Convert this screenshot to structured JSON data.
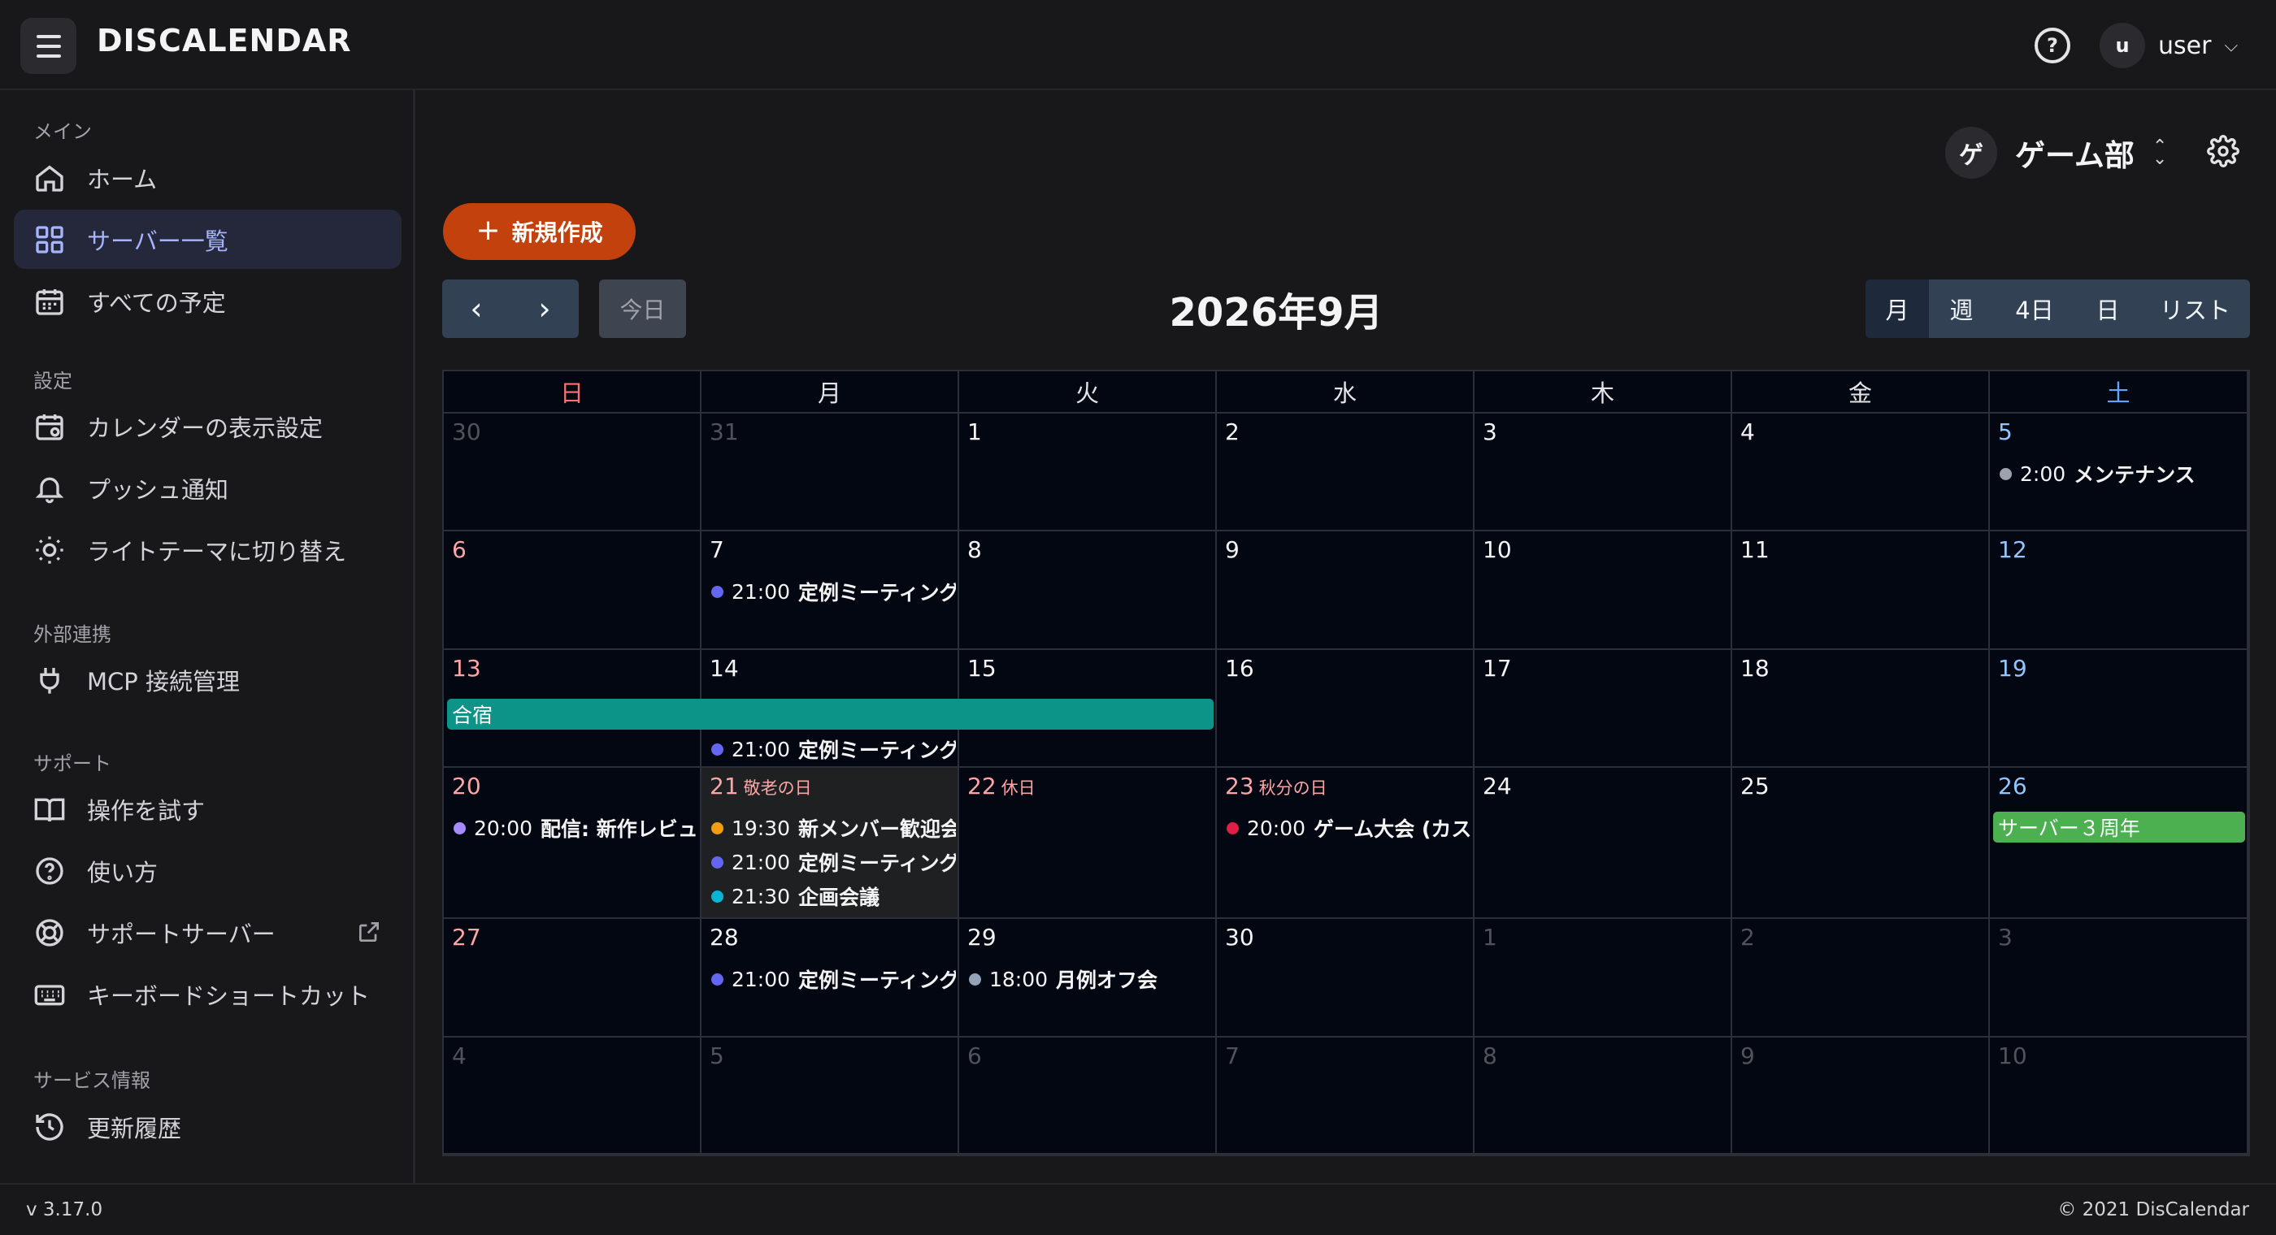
{
  "app": {
    "brand": "DISCALENDAR"
  },
  "header": {
    "help_icon": "help-circle-icon",
    "user": {
      "initial": "u",
      "name": "user"
    }
  },
  "sidebar": {
    "sections": [
      {
        "title": "メイン",
        "items": [
          {
            "label": "ホーム",
            "icon": "home-icon"
          },
          {
            "label": "サーバー一覧",
            "icon": "grid-icon",
            "active": true
          },
          {
            "label": "すべての予定",
            "icon": "calendar-icon"
          }
        ]
      },
      {
        "title": "設定",
        "items": [
          {
            "label": "カレンダーの表示設定",
            "icon": "calendar-settings-icon"
          },
          {
            "label": "プッシュ通知",
            "icon": "bell-icon"
          },
          {
            "label": "ライトテーマに切り替え",
            "icon": "sun-icon"
          }
        ]
      },
      {
        "title": "外部連携",
        "items": [
          {
            "label": "MCP 接続管理",
            "icon": "plug-icon"
          }
        ]
      },
      {
        "title": "サポート",
        "items": [
          {
            "label": "操作を試す",
            "icon": "book-icon"
          },
          {
            "label": "使い方",
            "icon": "help-circle-icon"
          },
          {
            "label": "サポートサーバー",
            "icon": "lifebuoy-icon",
            "external": true
          },
          {
            "label": "キーボードショートカット",
            "icon": "keyboard-icon"
          }
        ]
      },
      {
        "title": "サービス情報",
        "items": [
          {
            "label": "更新履歴",
            "icon": "history-icon"
          }
        ]
      }
    ]
  },
  "footer": {
    "version": "v 3.17.0",
    "copyright": "© 2021 DisCalendar"
  },
  "server": {
    "initial": "ゲ",
    "name": "ゲーム部"
  },
  "toolbar": {
    "new_label": "新規作成",
    "prev": "‹",
    "next": "›",
    "today_label": "今日",
    "title": "2026年9月",
    "views": [
      "月",
      "週",
      "4日",
      "日",
      "リスト"
    ],
    "active_view": "月"
  },
  "calendar": {
    "weekdays": [
      "日",
      "月",
      "火",
      "水",
      "木",
      "金",
      "土"
    ],
    "weeks": [
      [
        {
          "d": "30",
          "o": true
        },
        {
          "d": "31",
          "o": true
        },
        {
          "d": "1"
        },
        {
          "d": "2"
        },
        {
          "d": "3"
        },
        {
          "d": "4"
        },
        {
          "d": "5"
        }
      ],
      [
        {
          "d": "6"
        },
        {
          "d": "7"
        },
        {
          "d": "8"
        },
        {
          "d": "9"
        },
        {
          "d": "10"
        },
        {
          "d": "11"
        },
        {
          "d": "12"
        }
      ],
      [
        {
          "d": "13"
        },
        {
          "d": "14"
        },
        {
          "d": "15"
        },
        {
          "d": "16"
        },
        {
          "d": "17"
        },
        {
          "d": "18"
        },
        {
          "d": "19"
        }
      ],
      [
        {
          "d": "20"
        },
        {
          "d": "21",
          "h": "敬老の日",
          "today": true
        },
        {
          "d": "22",
          "h": "休日"
        },
        {
          "d": "23",
          "h": "秋分の日"
        },
        {
          "d": "24"
        },
        {
          "d": "25"
        },
        {
          "d": "26"
        }
      ],
      [
        {
          "d": "27"
        },
        {
          "d": "28"
        },
        {
          "d": "29"
        },
        {
          "d": "30"
        },
        {
          "d": "1",
          "o": true
        },
        {
          "d": "2",
          "o": true
        },
        {
          "d": "3",
          "o": true
        }
      ],
      [
        {
          "d": "4",
          "o": true
        },
        {
          "d": "5",
          "o": true
        },
        {
          "d": "6",
          "o": true
        },
        {
          "d": "7",
          "o": true
        },
        {
          "d": "8",
          "o": true
        },
        {
          "d": "9",
          "o": true
        },
        {
          "d": "10",
          "o": true
        }
      ]
    ],
    "events": [
      {
        "week": 0,
        "day": 6,
        "slot": 0,
        "time": "2:00",
        "title": "メンテナンス",
        "color": "#9ca3af"
      },
      {
        "week": 1,
        "day": 1,
        "slot": 0,
        "time": "21:00",
        "title": "定例ミーティング",
        "color": "#6366f1"
      },
      {
        "week": 2,
        "day": 1,
        "slot": 1,
        "time": "21:00",
        "title": "定例ミーティング",
        "color": "#6366f1"
      },
      {
        "week": 3,
        "day": 0,
        "slot": 0,
        "time": "20:00",
        "title": "配信: 新作レビュー",
        "color": "#a78bfa"
      },
      {
        "week": 3,
        "day": 1,
        "slot": 0,
        "time": "19:30",
        "title": "新メンバー歓迎会",
        "color": "#f59e0b"
      },
      {
        "week": 3,
        "day": 1,
        "slot": 1,
        "time": "21:00",
        "title": "定例ミーティング",
        "color": "#6366f1"
      },
      {
        "week": 3,
        "day": 1,
        "slot": 2,
        "time": "21:30",
        "title": "企画会議",
        "color": "#06b6d4"
      },
      {
        "week": 3,
        "day": 3,
        "slot": 0,
        "time": "20:00",
        "title": "ゲーム大会 (カスタム)",
        "color": "#e11d48"
      },
      {
        "week": 4,
        "day": 1,
        "slot": 0,
        "time": "21:00",
        "title": "定例ミーティング",
        "color": "#6366f1"
      },
      {
        "week": 4,
        "day": 2,
        "slot": 0,
        "time": "18:00",
        "title": "月例オフ会",
        "color": "#94a3b8"
      }
    ],
    "allday": [
      {
        "week": 2,
        "start": 0,
        "end": 2,
        "title": "合宿",
        "color": "#0d9488"
      },
      {
        "week": 3,
        "start": 6,
        "end": 6,
        "title": "サーバー３周年",
        "color": "#4caf50"
      }
    ]
  }
}
